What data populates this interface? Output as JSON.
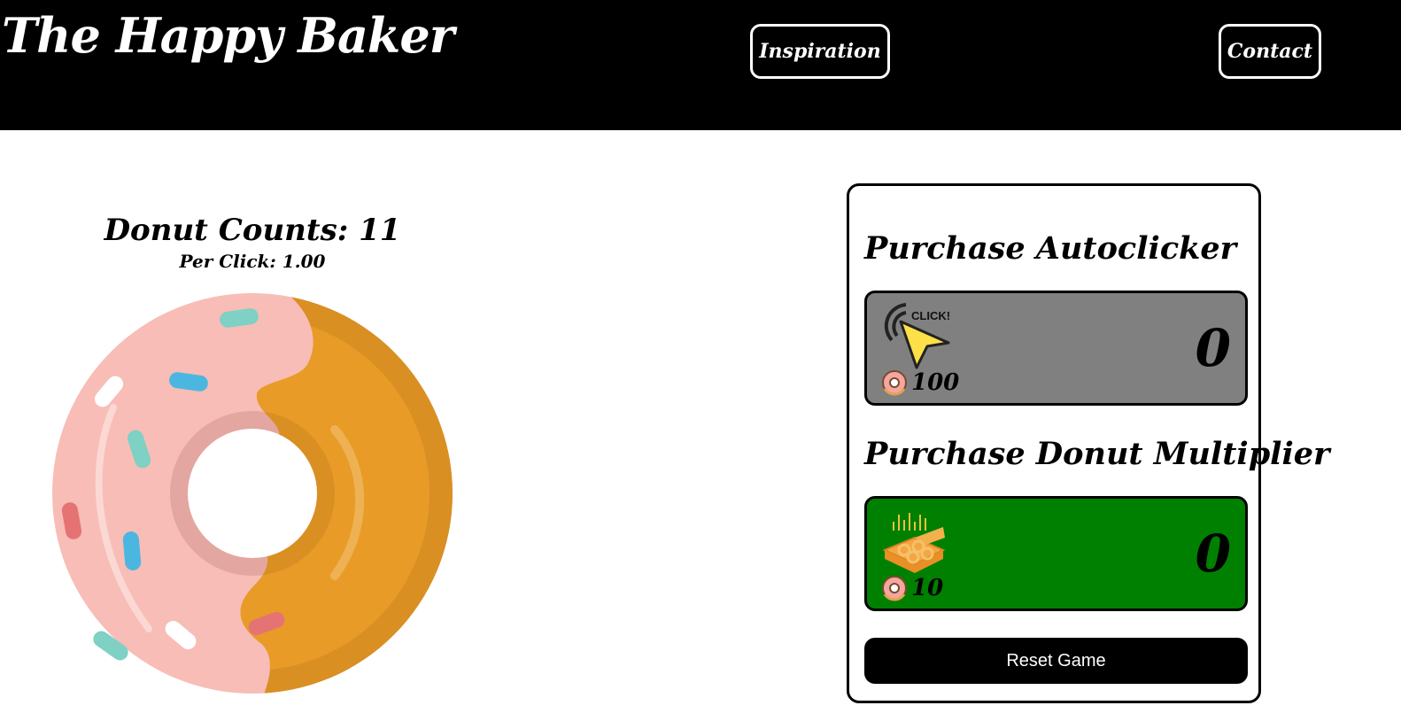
{
  "header": {
    "brand": "The Happy Baker",
    "nav": {
      "inspiration": "Inspiration",
      "contact": "Contact"
    }
  },
  "game": {
    "donut_count_text": "Donut Counts: 11",
    "per_click_text": "Per Click: 1.00",
    "donut_icon": "donut-image"
  },
  "shop": {
    "autoclicker": {
      "title": "Purchase Autoclicker",
      "icon": "click-cursor-icon",
      "price": "100",
      "owned": "0",
      "card_color": "#808080"
    },
    "multiplier": {
      "title": "Purchase Donut Multiplier",
      "icon": "donut-box-icon",
      "price": "10",
      "owned": "0",
      "card_color": "#008000"
    },
    "reset_label": "Reset Game"
  },
  "colors": {
    "header_bg": "#000000",
    "icing": "#f7bdb6",
    "dough": "#e89b27"
  }
}
